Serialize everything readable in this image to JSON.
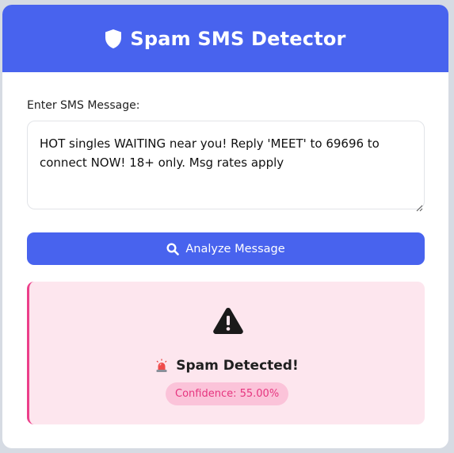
{
  "header": {
    "title": "Spam SMS Detector",
    "icon": "shield-icon"
  },
  "form": {
    "message_label": "Enter SMS Message:",
    "message_value": "HOT singles WAITING near you! Reply 'MEET' to 69696 to connect NOW! 18+ only. Msg rates apply",
    "analyze_label": "Analyze Message",
    "analyze_icon": "search-icon"
  },
  "result": {
    "icon": "warning-icon",
    "status_icon": "siren-icon",
    "title": "Spam Detected!",
    "confidence": "Confidence: 55.00%"
  },
  "colors": {
    "primary": "#4863ee",
    "spam_bg": "#fde6ee",
    "spam_accent": "#ec3f8a",
    "badge_bg": "#fbc3d9"
  }
}
